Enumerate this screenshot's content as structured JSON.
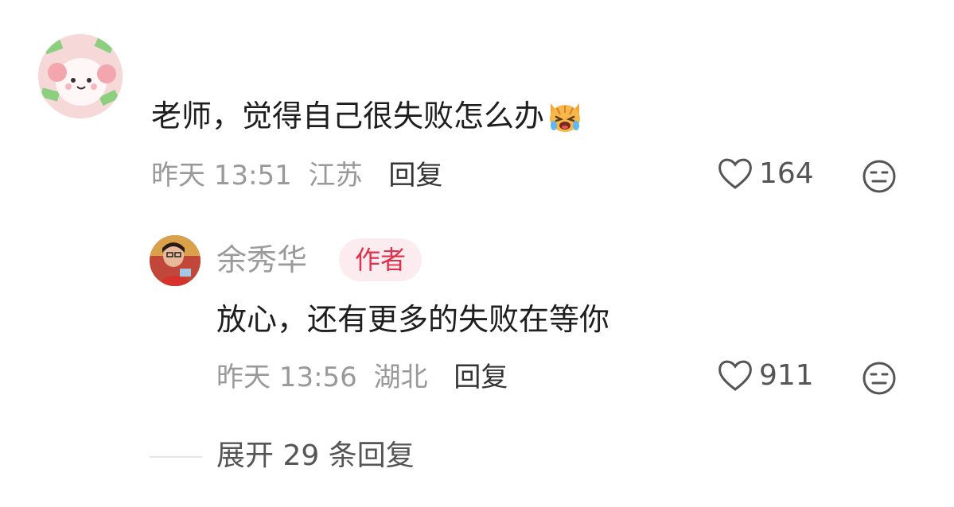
{
  "comment": {
    "text": "老师，觉得自己很失败怎么办",
    "emoji": "crying-cat-emoji",
    "time": "昨天 13:51",
    "location": "江苏",
    "reply_label": "回复",
    "like_count": "164",
    "dislike_icon": "meh-face-icon"
  },
  "reply": {
    "author": "余秀华",
    "badge": "作者",
    "text": "放心，还有更多的失败在等你",
    "time": "昨天 13:56",
    "location": "湖北",
    "reply_label": "回复",
    "like_count": "911",
    "dislike_icon": "meh-face-icon"
  },
  "expand": {
    "label": "展开 29 条回复"
  },
  "colors": {
    "badge_bg": "#fdecef",
    "badge_text": "#e0314b",
    "meta_text": "#999999",
    "body_text": "#1e1e1e"
  }
}
